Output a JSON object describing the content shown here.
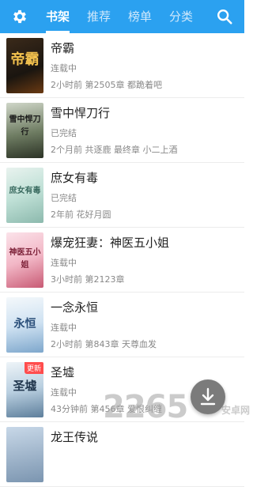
{
  "colors": {
    "header": "#2ba1f0",
    "tab_active": "#ffffff",
    "tab_inactive": "#cfe8fb"
  },
  "header": {
    "settings_icon": "gear-icon",
    "search_icon": "search-icon",
    "tabs": [
      {
        "label": "书架",
        "active": true
      },
      {
        "label": "推荐",
        "active": false
      },
      {
        "label": "榜单",
        "active": false
      },
      {
        "label": "分类",
        "active": false
      }
    ]
  },
  "books": [
    {
      "title": "帝霸",
      "status": "连载中",
      "meta": "2小时前 第2505章 都跪着吧",
      "cover_text": "帝霸",
      "badge": ""
    },
    {
      "title": "雪中悍刀行",
      "status": "已完结",
      "meta": "2个月前 共逐鹿 最终章 小二上酒",
      "cover_text": "雪中悍刀行",
      "badge": ""
    },
    {
      "title": "庶女有毒",
      "status": "已完结",
      "meta": "2年前 花好月圆",
      "cover_text": "庶女有毒",
      "badge": ""
    },
    {
      "title": "爆宠狂妻：神医五小姐",
      "status": "连载中",
      "meta": "3小时前 第2123章",
      "cover_text": "神医五小姐",
      "badge": ""
    },
    {
      "title": "一念永恒",
      "status": "连载中",
      "meta": "2小时前 第843章 天尊血发",
      "cover_text": "永恒",
      "badge": ""
    },
    {
      "title": "圣墟",
      "status": "连载中",
      "meta": "43分钟前 第456章 爱恨纠缠",
      "cover_text": "圣墟",
      "badge": "更新"
    },
    {
      "title": "龙王传说",
      "status": "",
      "meta": "",
      "cover_text": "",
      "badge": ""
    }
  ],
  "fab": {
    "icon": "download-icon"
  },
  "watermark": {
    "text": "2265",
    "sub": "安卓网"
  }
}
